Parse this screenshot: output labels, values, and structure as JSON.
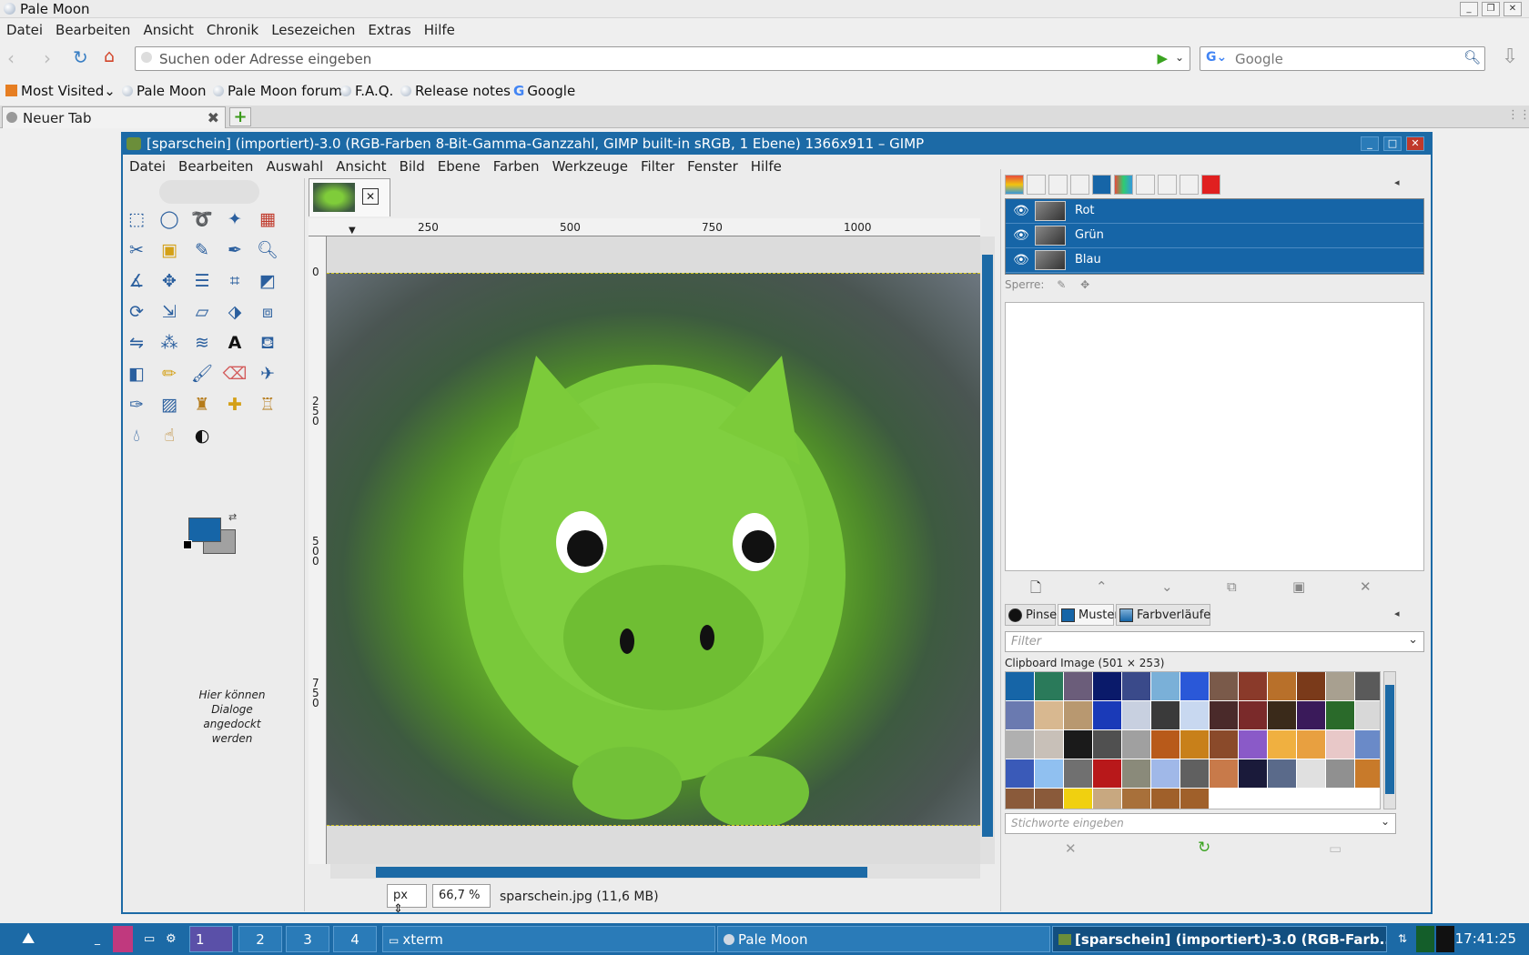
{
  "browser": {
    "title": "Pale Moon",
    "menu": [
      "Datei",
      "Bearbeiten",
      "Ansicht",
      "Chronik",
      "Lesezeichen",
      "Extras",
      "Hilfe"
    ],
    "url_placeholder": "Suchen oder Adresse eingeben",
    "search_placeholder": "Google",
    "bookmarks": [
      "Most Visited",
      "Pale Moon",
      "Pale Moon forum",
      "F.A.Q.",
      "Release notes",
      "Google"
    ],
    "tab_label": "Neuer Tab"
  },
  "gimp": {
    "title": "[sparschein] (importiert)-3.0 (RGB-Farben 8-Bit-Gamma-Ganzzahl, GIMP built-in sRGB, 1 Ebene) 1366x911 – GIMP",
    "menu": [
      "Datei",
      "Bearbeiten",
      "Auswahl",
      "Ansicht",
      "Bild",
      "Ebene",
      "Farben",
      "Werkzeuge",
      "Filter",
      "Fenster",
      "Hilfe"
    ],
    "dock_hint": "Hier können Dialoge angedockt werden",
    "ruler_top": [
      "250",
      "500",
      "750",
      "1000"
    ],
    "ruler_left": [
      "0",
      "2\n5\n0",
      "5\n0\n0",
      "7\n5\n0"
    ],
    "unit": "px",
    "zoom": "66,7 %",
    "status_file": "sparschein.jpg (11,6 MB)",
    "colors": {
      "foreground": "#1665a7",
      "background": "#a1a1a1",
      "accent": "#1c6aa6"
    },
    "channels": [
      "Rot",
      "Grün",
      "Blau"
    ],
    "lock_label": "Sperre:",
    "pattern_tabs": [
      "Pinsel",
      "Muster",
      "Farbverläufe"
    ],
    "filter_placeholder": "Filter",
    "clipboard_label": "Clipboard Image (501 × 253)",
    "tag_placeholder": "Stichworte eingeben"
  },
  "taskbar": {
    "workspaces": [
      "1",
      "2",
      "3",
      "4"
    ],
    "apps": [
      "xterm",
      "Pale Moon",
      "[sparschein] (importiert)-3.0 (RGB-Farb..."
    ],
    "clock": "17:41:25"
  }
}
